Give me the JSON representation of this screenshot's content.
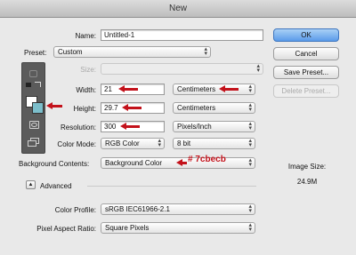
{
  "window": {
    "title": "New"
  },
  "form": {
    "name": {
      "label": "Name:",
      "value": "Untitled-1"
    },
    "preset": {
      "label": "Preset:",
      "value": "Custom"
    },
    "size": {
      "label": "Size:",
      "value": ""
    },
    "width": {
      "label": "Width:",
      "value": "21",
      "unit": "Centimeters"
    },
    "height": {
      "label": "Height:",
      "value": "29.7",
      "unit": "Centimeters"
    },
    "resolution": {
      "label": "Resolution:",
      "value": "300",
      "unit": "Pixels/Inch"
    },
    "color_mode": {
      "label": "Color Mode:",
      "value": "RGB Color",
      "depth": "8 bit"
    },
    "background": {
      "label": "Background Contents:",
      "value": "Background Color",
      "annotation": "# 7cbecb"
    },
    "advanced": {
      "label": "Advanced"
    },
    "color_profile": {
      "label": "Color Profile:",
      "value": "sRGB IEC61966-2.1"
    },
    "pixel_aspect": {
      "label": "Pixel Aspect Ratio:",
      "value": "Square Pixels"
    }
  },
  "buttons": {
    "ok": "OK",
    "cancel": "Cancel",
    "save_preset": "Save Preset...",
    "delete_preset": "Delete Preset..."
  },
  "image_size": {
    "label": "Image Size:",
    "value": "24.9M"
  },
  "colors": {
    "annotation": "#c3121b",
    "accent": "#5a9bea",
    "background_swatch": "#7cbecb"
  }
}
